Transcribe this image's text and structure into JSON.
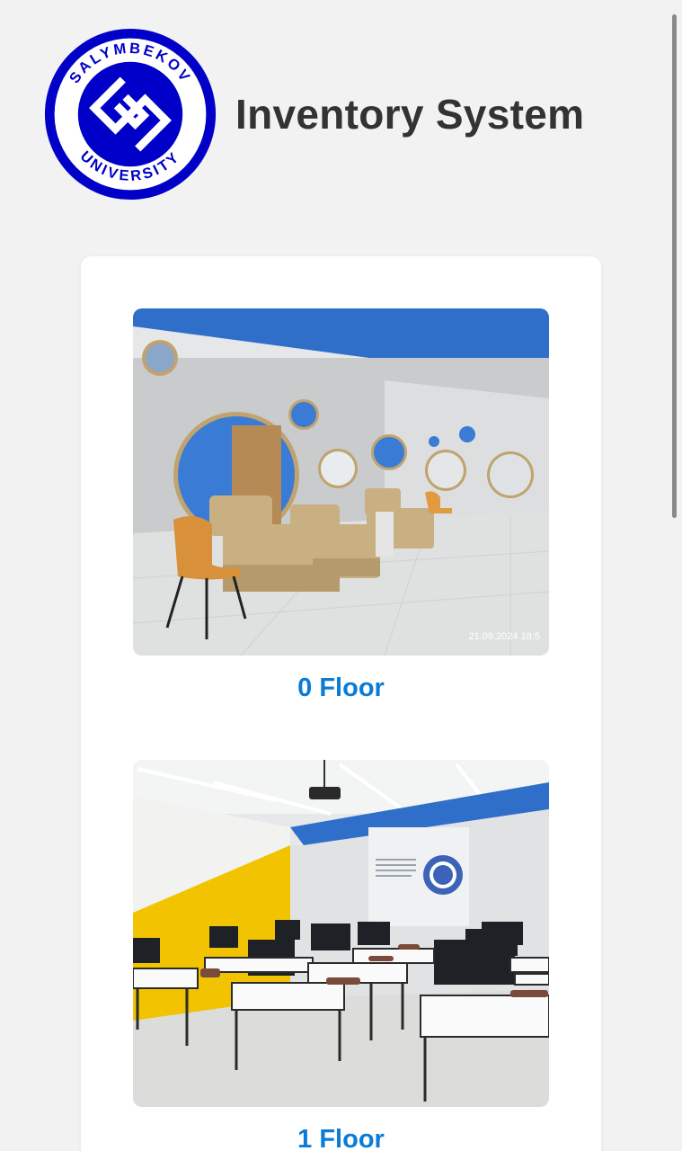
{
  "header": {
    "title": "Inventory System",
    "logo": {
      "top_text": "SALYMBEKOV",
      "bottom_text": "UNIVERSITY",
      "color": "#0000c8"
    }
  },
  "floors": [
    {
      "label": "0 Floor",
      "photo_timestamp": "21.09.2024 18:5"
    },
    {
      "label": "1 Floor"
    }
  ],
  "colors": {
    "accent": "#0a7bd6",
    "title": "#333333",
    "background": "#f2f2f2",
    "card": "#ffffff"
  }
}
